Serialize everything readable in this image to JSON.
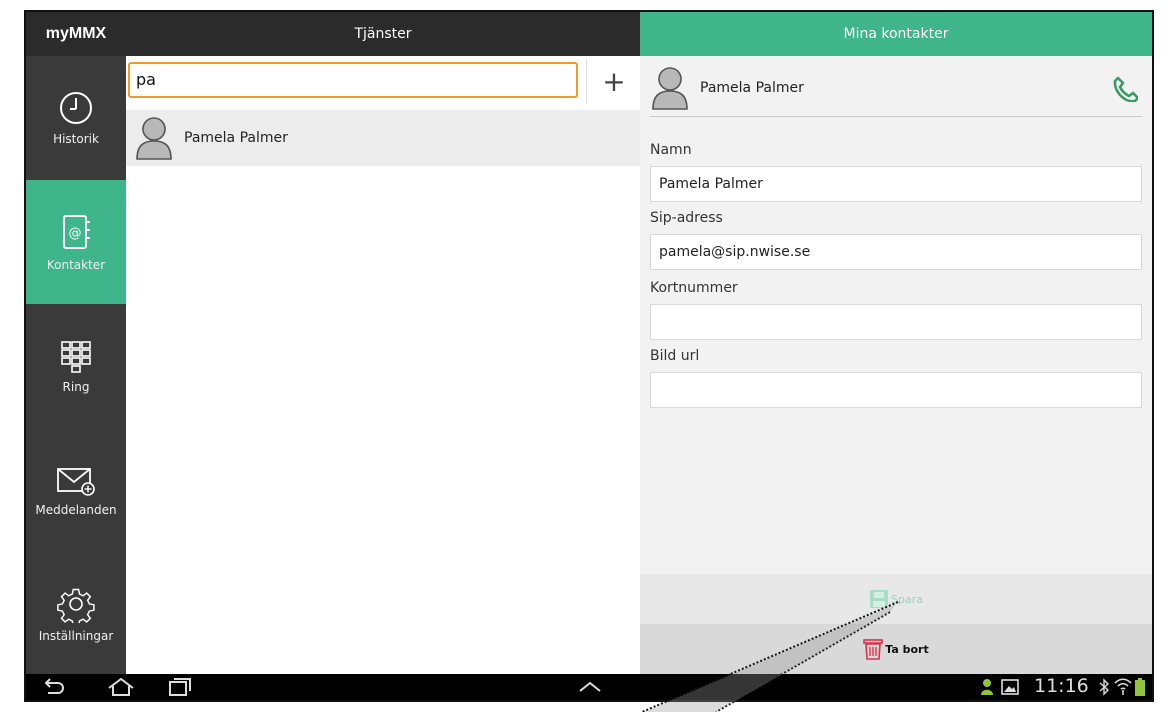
{
  "app": {
    "logo": "myMMX"
  },
  "sidebar": {
    "items": [
      {
        "label": "Historik",
        "icon": "clock-icon",
        "active": false
      },
      {
        "label": "Kontakter",
        "icon": "address-book-icon",
        "active": true
      },
      {
        "label": "Ring",
        "icon": "dialpad-icon",
        "active": false
      },
      {
        "label": "Meddelanden",
        "icon": "envelope-icon",
        "active": false
      },
      {
        "label": "Inställningar",
        "icon": "gear-icon",
        "active": false
      }
    ]
  },
  "middle": {
    "header": "Tjänster",
    "search_value": "pa",
    "add_label": "+",
    "results": [
      {
        "name": "Pamela Palmer"
      }
    ]
  },
  "right": {
    "header": "Mina kontakter",
    "contact_name": "Pamela Palmer",
    "fields": [
      {
        "label": "Namn",
        "value": "Pamela Palmer"
      },
      {
        "label": "Sip-adress",
        "value": "pamela@sip.nwise.se"
      },
      {
        "label": "Kortnummer",
        "value": ""
      },
      {
        "label": "Bild url",
        "value": ""
      }
    ],
    "save_label": "Spara",
    "delete_label": "Ta bort"
  },
  "statusbar": {
    "time": "11:16"
  },
  "colors": {
    "accent": "#3eb58b",
    "search_border": "#f09a2a",
    "phone": "#3a9a63",
    "delete": "#e0304a"
  }
}
